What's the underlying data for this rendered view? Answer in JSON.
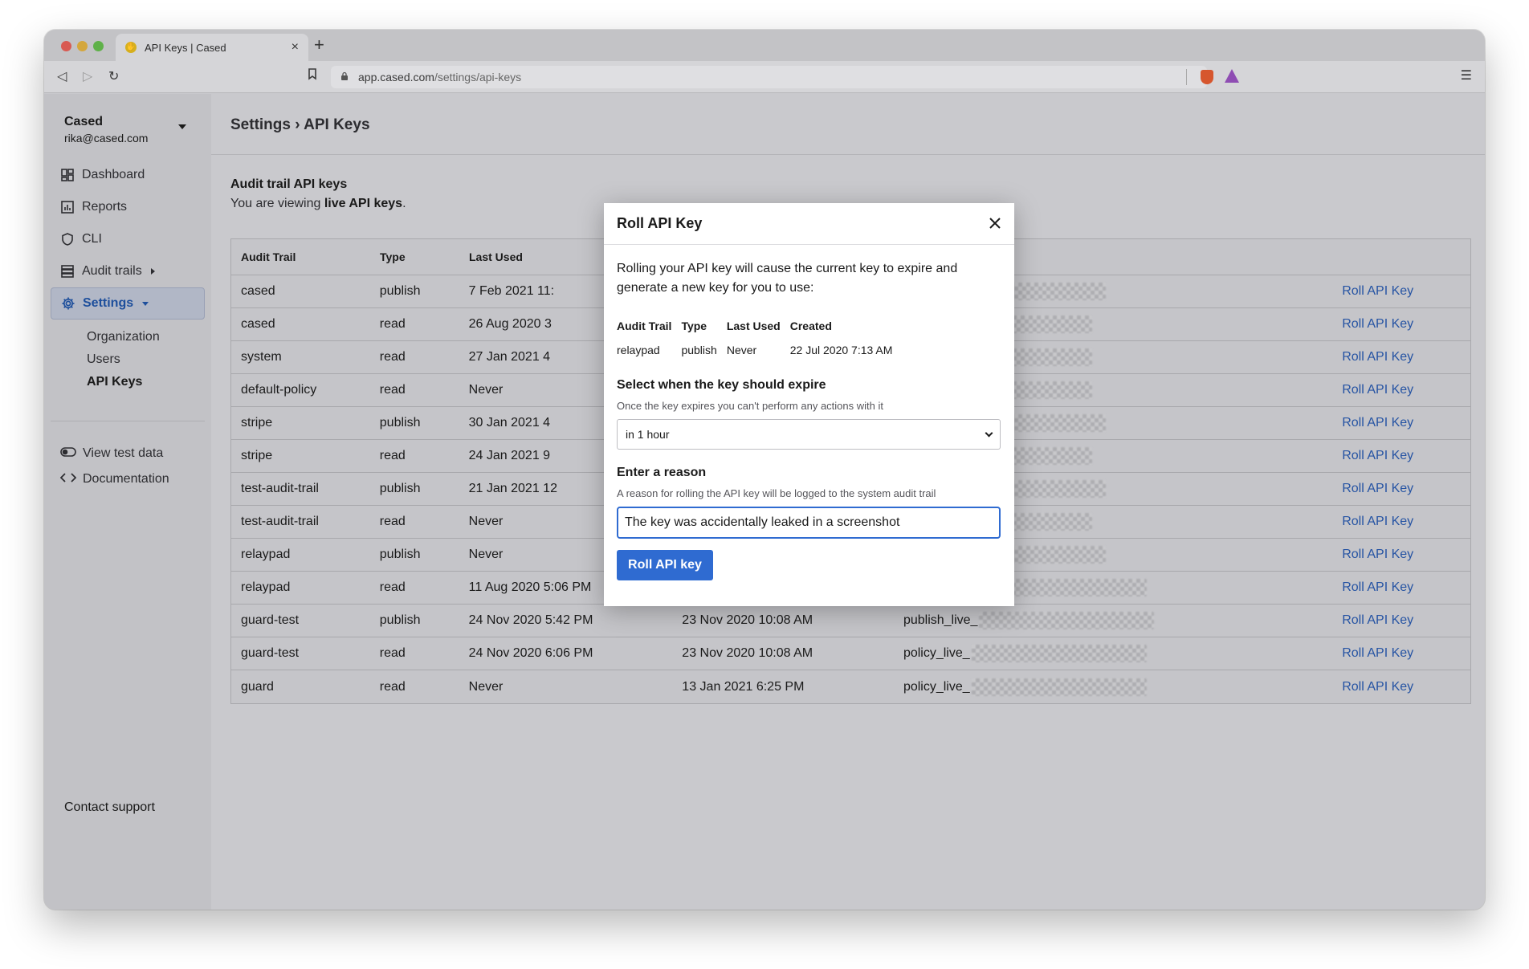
{
  "browser": {
    "tab_title": "API Keys | Cased",
    "url_host": "app.cased.com",
    "url_path": "/settings/api-keys"
  },
  "sidebar": {
    "account_name": "Cased",
    "account_email": "rika@cased.com",
    "nav": {
      "dashboard": "Dashboard",
      "reports": "Reports",
      "cli": "CLI",
      "audit_trails": "Audit trails",
      "settings": "Settings"
    },
    "settings_sub": {
      "organization": "Organization",
      "users": "Users",
      "api_keys": "API Keys"
    },
    "view_test_data": "View test data",
    "documentation": "Documentation",
    "contact_support": "Contact support"
  },
  "main": {
    "breadcrumb": "Settings › API Keys",
    "section_title": "Audit trail API keys",
    "section_sub_prefix": "You are viewing",
    "section_sub_bold": "live API keys",
    "section_sub_suffix": "."
  },
  "table": {
    "headers": {
      "audit_trail": "Audit Trail",
      "type": "Type",
      "last_used": "Last Used"
    },
    "rows": [
      {
        "trail": "cased",
        "type": "publish",
        "last_used": "7 Feb 2021 11:",
        "created": "",
        "key_prefix": "ve_",
        "action": "Roll API Key"
      },
      {
        "trail": "cased",
        "type": "read",
        "last_used": "26 Aug 2020 3",
        "created": "",
        "key_prefix": "_",
        "action": "Roll API Key"
      },
      {
        "trail": "system",
        "type": "read",
        "last_used": "27 Jan 2021 4",
        "created": "",
        "key_prefix": "_",
        "action": "Roll API Key"
      },
      {
        "trail": "default-policy",
        "type": "read",
        "last_used": "Never",
        "created": "",
        "key_prefix": "_",
        "action": "Roll API Key"
      },
      {
        "trail": "stripe",
        "type": "publish",
        "last_used": "30 Jan 2021 4",
        "created": "",
        "key_prefix": "ve_",
        "action": "Roll API Key"
      },
      {
        "trail": "stripe",
        "type": "read",
        "last_used": "24 Jan 2021 9",
        "created": "",
        "key_prefix": "_",
        "action": "Roll API Key"
      },
      {
        "trail": "test-audit-trail",
        "type": "publish",
        "last_used": "21 Jan 2021 12",
        "created": "",
        "key_prefix": "ve_",
        "action": "Roll API Key"
      },
      {
        "trail": "test-audit-trail",
        "type": "read",
        "last_used": "Never",
        "created": "",
        "key_prefix": "_",
        "action": "Roll API Key"
      },
      {
        "trail": "relaypad",
        "type": "publish",
        "last_used": "Never",
        "created": "",
        "key_prefix": "ve_",
        "action": "Roll API Key"
      },
      {
        "trail": "relaypad",
        "type": "read",
        "last_used": "11 Aug 2020 5:06 PM",
        "created": "22 Jul 2020 7:13 AM",
        "key_prefix": "policy_live_",
        "action": "Roll API Key"
      },
      {
        "trail": "guard-test",
        "type": "publish",
        "last_used": "24 Nov 2020 5:42 PM",
        "created": "23 Nov 2020 10:08 AM",
        "key_prefix": "publish_live_",
        "action": "Roll API Key"
      },
      {
        "trail": "guard-test",
        "type": "read",
        "last_used": "24 Nov 2020 6:06 PM",
        "created": "23 Nov 2020 10:08 AM",
        "key_prefix": "policy_live_",
        "action": "Roll API Key"
      },
      {
        "trail": "guard",
        "type": "read",
        "last_used": "Never",
        "created": "13 Jan 2021 6:25 PM",
        "key_prefix": "policy_live_",
        "action": "Roll API Key"
      }
    ]
  },
  "modal": {
    "title": "Roll API Key",
    "description": "Rolling your API key will cause the current key to expire and generate a new key for you to use:",
    "key_table": {
      "headers": {
        "audit_trail": "Audit Trail",
        "type": "Type",
        "last_used": "Last Used",
        "created": "Created"
      },
      "row": {
        "audit_trail": "relaypad",
        "type": "publish",
        "last_used": "Never",
        "created": "22 Jul 2020 7:13 AM"
      }
    },
    "expire_label": "Select when the key should expire",
    "expire_help": "Once the key expires you can't perform any actions with it",
    "expire_value": "in 1 hour",
    "reason_label": "Enter a reason",
    "reason_help": "A reason for rolling the API key will be logged to the system audit trail",
    "reason_value": "The key was accidentally leaked in a screenshot",
    "submit_label": "Roll API key"
  }
}
